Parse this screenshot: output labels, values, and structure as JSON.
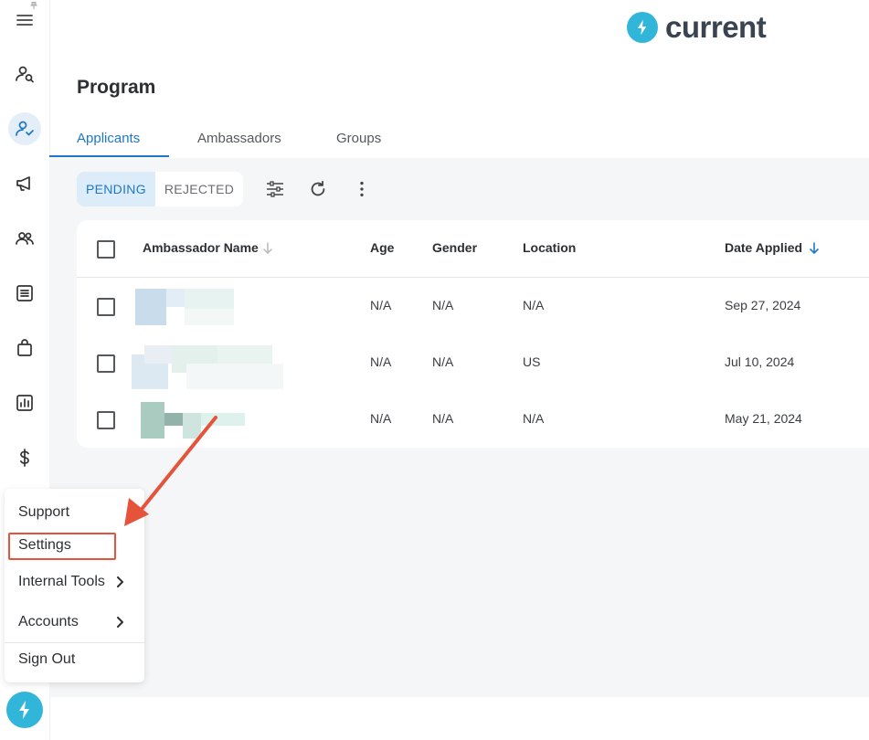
{
  "brand": {
    "name": "current",
    "accent": "#31b6d9"
  },
  "page": {
    "title": "Program"
  },
  "tabs": [
    {
      "label": "Applicants",
      "active": true
    },
    {
      "label": "Ambassadors",
      "active": false
    },
    {
      "label": "Groups",
      "active": false
    }
  ],
  "filters": {
    "pending_label": "PENDING",
    "rejected_label": "REJECTED",
    "selected": "PENDING"
  },
  "toolbar": {
    "icons": [
      "filter-sliders-icon",
      "refresh-icon",
      "more-vertical-icon"
    ]
  },
  "table": {
    "columns": [
      "Ambassador Name",
      "Age",
      "Gender",
      "Location",
      "Date Applied"
    ],
    "sort": {
      "column": "Date Applied",
      "direction": "desc"
    },
    "rows": [
      {
        "age": "N/A",
        "gender": "N/A",
        "location": "N/A",
        "date_applied": "Sep 27, 2024"
      },
      {
        "age": "N/A",
        "gender": "N/A",
        "location": "US",
        "date_applied": "Jul 10, 2024"
      },
      {
        "age": "N/A",
        "gender": "N/A",
        "location": "N/A",
        "date_applied": "May 21, 2024"
      }
    ]
  },
  "sidebar": {
    "icons": [
      "menu-icon",
      "search-user-icon",
      "user-check-icon",
      "megaphone-icon",
      "users-icon",
      "content-list-icon",
      "shopping-bag-icon",
      "analytics-icon",
      "dollar-icon"
    ],
    "active": "user-check-icon"
  },
  "menu": {
    "items": [
      {
        "label": "Support"
      },
      {
        "label": "Settings",
        "highlighted": true
      },
      {
        "label": "Internal Tools",
        "submenu": true
      },
      {
        "label": "Accounts",
        "submenu": true
      },
      {
        "label": "Sign Out"
      }
    ],
    "highlight_color": "#e5533a"
  }
}
